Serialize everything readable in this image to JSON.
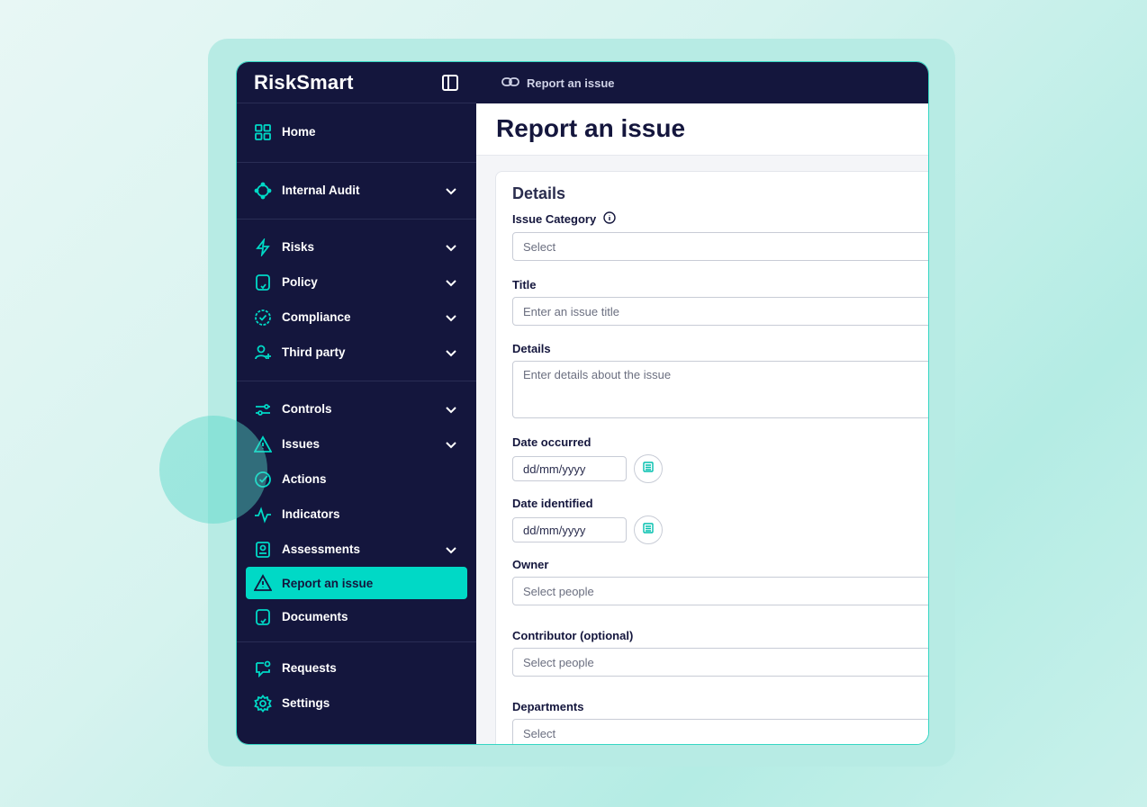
{
  "app": {
    "brand": "RiskSmart"
  },
  "topbar": {
    "breadcrumb": "Report an issue"
  },
  "sidebar": {
    "items": [
      {
        "label": "Home"
      },
      {
        "label": "Internal Audit"
      },
      {
        "label": "Risks"
      },
      {
        "label": "Policy"
      },
      {
        "label": "Compliance"
      },
      {
        "label": "Third party"
      },
      {
        "label": "Controls"
      },
      {
        "label": "Issues"
      },
      {
        "label": "Actions"
      },
      {
        "label": "Indicators"
      },
      {
        "label": "Assessments"
      },
      {
        "label": "Report an issue"
      },
      {
        "label": "Documents"
      },
      {
        "label": "Requests"
      },
      {
        "label": "Settings"
      }
    ]
  },
  "main": {
    "title": "Report an issue",
    "section": "Details",
    "fields": {
      "category": {
        "label": "Issue Category",
        "placeholder": "Select"
      },
      "title": {
        "label": "Title",
        "placeholder": "Enter an issue title"
      },
      "details": {
        "label": "Details",
        "placeholder": "Enter details about the issue"
      },
      "date_occurred": {
        "label": "Date occurred",
        "placeholder": "dd/mm/yyyy"
      },
      "date_identified": {
        "label": "Date identified",
        "placeholder": "dd/mm/yyyy"
      },
      "owner": {
        "label": "Owner",
        "placeholder": "Select people"
      },
      "contributor": {
        "label": "Contributor (optional)",
        "placeholder": "Select people"
      },
      "departments": {
        "label": "Departments",
        "placeholder": "Select"
      }
    }
  },
  "colors": {
    "sidebar": "#14163d",
    "accent": "#00d9c6",
    "active_text": "#14163d"
  }
}
